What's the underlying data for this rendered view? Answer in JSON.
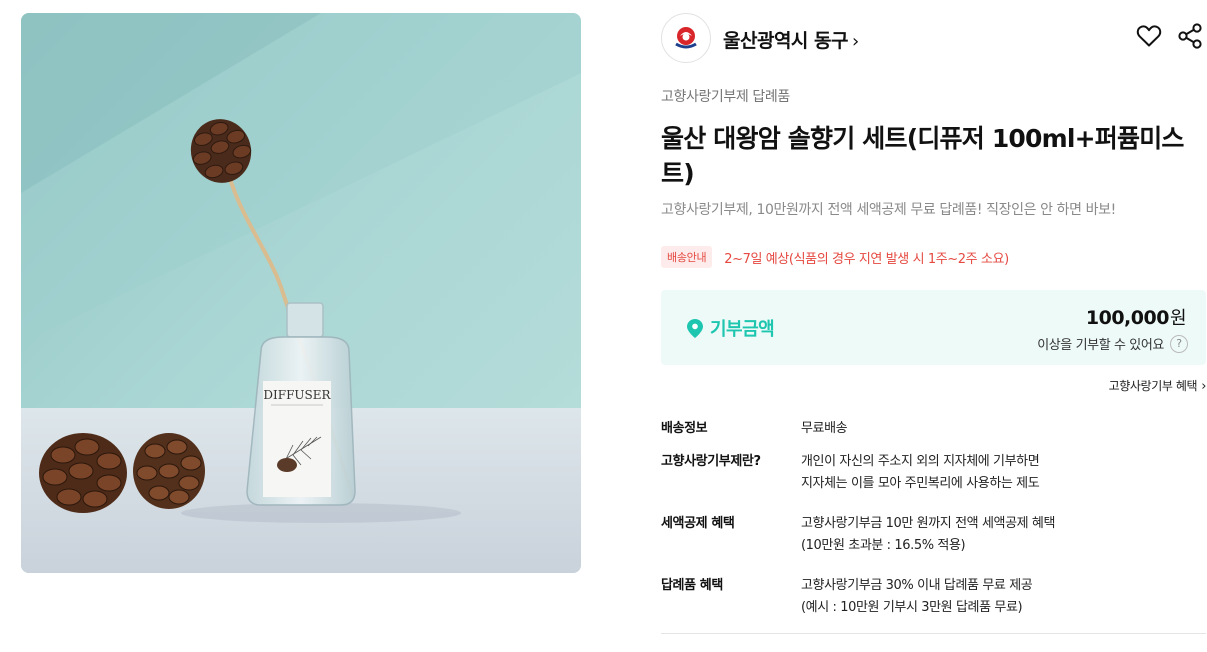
{
  "seller": {
    "name": "울산광역시 동구",
    "chevron": "›",
    "logo_icon": "donggu-emblem-icon"
  },
  "actions": {
    "like_icon": "heart-icon",
    "share_icon": "share-icon"
  },
  "product": {
    "category": "고향사랑기부제 답례품",
    "title": "울산 대왕암 솔향기 세트(디퓨저 100ml+퍼퓸미스트)",
    "subtitle": "고향사랑기부제, 10만원까지 전액 세액공제 무료 답례품! 직장인은 안 하면 바보!",
    "image_label": "DIFFUSER"
  },
  "shipping": {
    "badge": "배송안내",
    "text": "2~7일 예상(식품의 경우 지연 발생 시 1주~2주 소요)"
  },
  "donation": {
    "label": "기부금액",
    "amount": "100,000",
    "unit": "원",
    "note": "이상을 기부할 수 있어요",
    "help": "?"
  },
  "benefit_link": {
    "label": "고향사랑기부 혜택",
    "chevron": "›"
  },
  "details": [
    {
      "label": "배송정보",
      "lines": [
        "무료배송"
      ]
    },
    {
      "label": "고향사랑기부제란?",
      "lines": [
        "개인이 자신의 주소지 외의 지자체에 기부하면",
        "지자체는 이를 모아 주민복리에 사용하는 제도"
      ]
    },
    {
      "label": "세액공제 혜택",
      "lines": [
        "고향사랑기부금 10만 원까지 전액 세액공제 혜택",
        "(10만원 초과분 : 16.5% 적용)"
      ]
    },
    {
      "label": "답례품 혜택",
      "lines": [
        "고향사랑기부금 30% 이내 답례품 무료 제공",
        "(예시 : 10만원 기부시 3만원 답례품 무료)"
      ]
    }
  ],
  "colors": {
    "accent": "#1ec6b0",
    "donation_bg": "#eefaf8",
    "shipping_red": "#e54941"
  }
}
